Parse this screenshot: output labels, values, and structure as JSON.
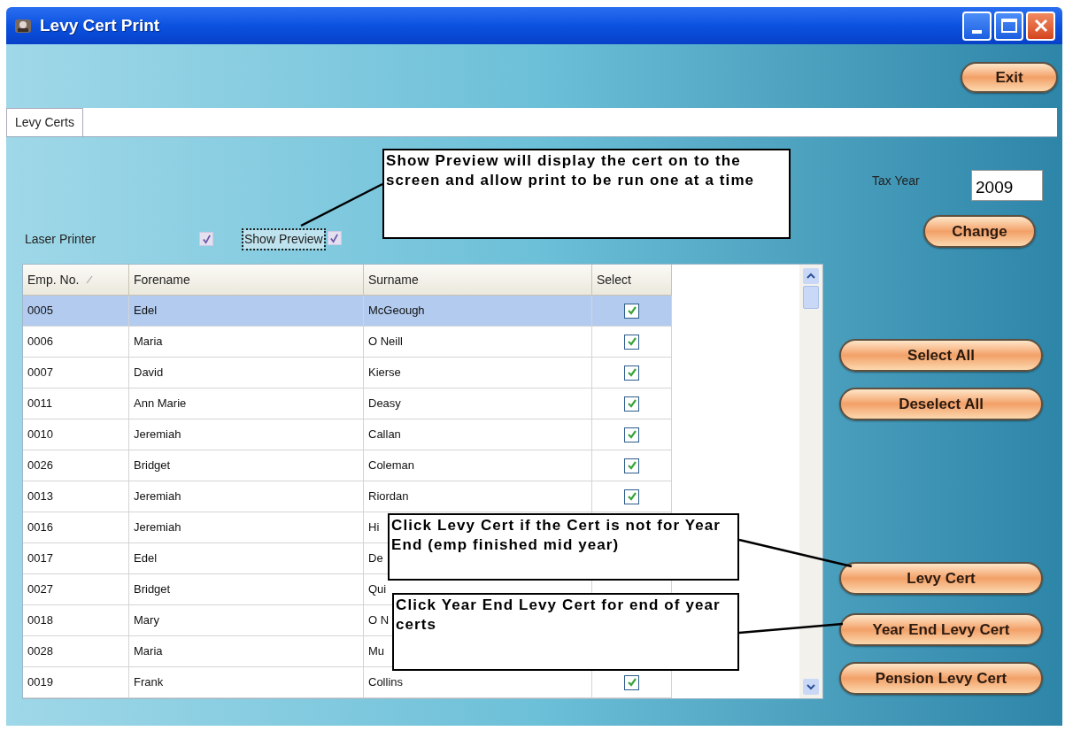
{
  "window": {
    "title": "Levy Cert Print"
  },
  "exit_button": "Exit",
  "tabs": [
    {
      "label": "Levy Certs",
      "selected": true
    }
  ],
  "options": [
    {
      "label": "Laser Printer",
      "checked": true
    },
    {
      "label": "Show Preview",
      "checked": true,
      "focused": true
    }
  ],
  "tax_year": {
    "label": "Tax Year",
    "value": "2009"
  },
  "change_button": "Change",
  "table": {
    "columns": [
      {
        "label": "Emp. No.",
        "sorted": true
      },
      {
        "label": "Forename",
        "sorted": false
      },
      {
        "label": "Surname",
        "sorted": false
      },
      {
        "label": "Select",
        "sorted": false
      }
    ],
    "rows": [
      {
        "emp_no": "0005",
        "forename": "Edel",
        "surname": "McGeough",
        "checked": true,
        "selected": true
      },
      {
        "emp_no": "0006",
        "forename": "Maria",
        "surname": "O Neill",
        "checked": true,
        "selected": false
      },
      {
        "emp_no": "0007",
        "forename": "David",
        "surname": "Kierse",
        "checked": true,
        "selected": false
      },
      {
        "emp_no": "0011",
        "forename": "Ann Marie",
        "surname": "Deasy",
        "checked": true,
        "selected": false
      },
      {
        "emp_no": "0010",
        "forename": "Jeremiah",
        "surname": "Callan",
        "checked": true,
        "selected": false
      },
      {
        "emp_no": "0026",
        "forename": "Bridget",
        "surname": "Coleman",
        "checked": true,
        "selected": false
      },
      {
        "emp_no": "0013",
        "forename": "Jeremiah",
        "surname": "Riordan",
        "checked": true,
        "selected": false
      },
      {
        "emp_no": "0016",
        "forename": "Jeremiah",
        "surname": "Hi",
        "selected": false
      },
      {
        "emp_no": "0017",
        "forename": "Edel",
        "surname": "De",
        "selected": false
      },
      {
        "emp_no": "0027",
        "forename": "Bridget",
        "surname": "Qui",
        "selected": false
      },
      {
        "emp_no": "0018",
        "forename": "Mary",
        "surname": "O N",
        "selected": false
      },
      {
        "emp_no": "0028",
        "forename": "Maria",
        "surname": "Mu",
        "selected": false
      },
      {
        "emp_no": "0019",
        "forename": "Frank",
        "surname": "Collins",
        "checked": true,
        "selected": false
      }
    ]
  },
  "selection_buttons": [
    "Select All",
    "Deselect All"
  ],
  "print_buttons": [
    "Levy Cert",
    "Year End Levy Cert",
    "Pension Levy Cert"
  ],
  "callouts": [
    {
      "text": "Show Preview will display the cert on to the screen and allow print to be run one at a time"
    },
    {
      "text": "Click Levy Cert if the Cert is not for Year End (emp finished mid year)"
    },
    {
      "text": "Click Year End Levy Cert for end of year certs"
    }
  ]
}
